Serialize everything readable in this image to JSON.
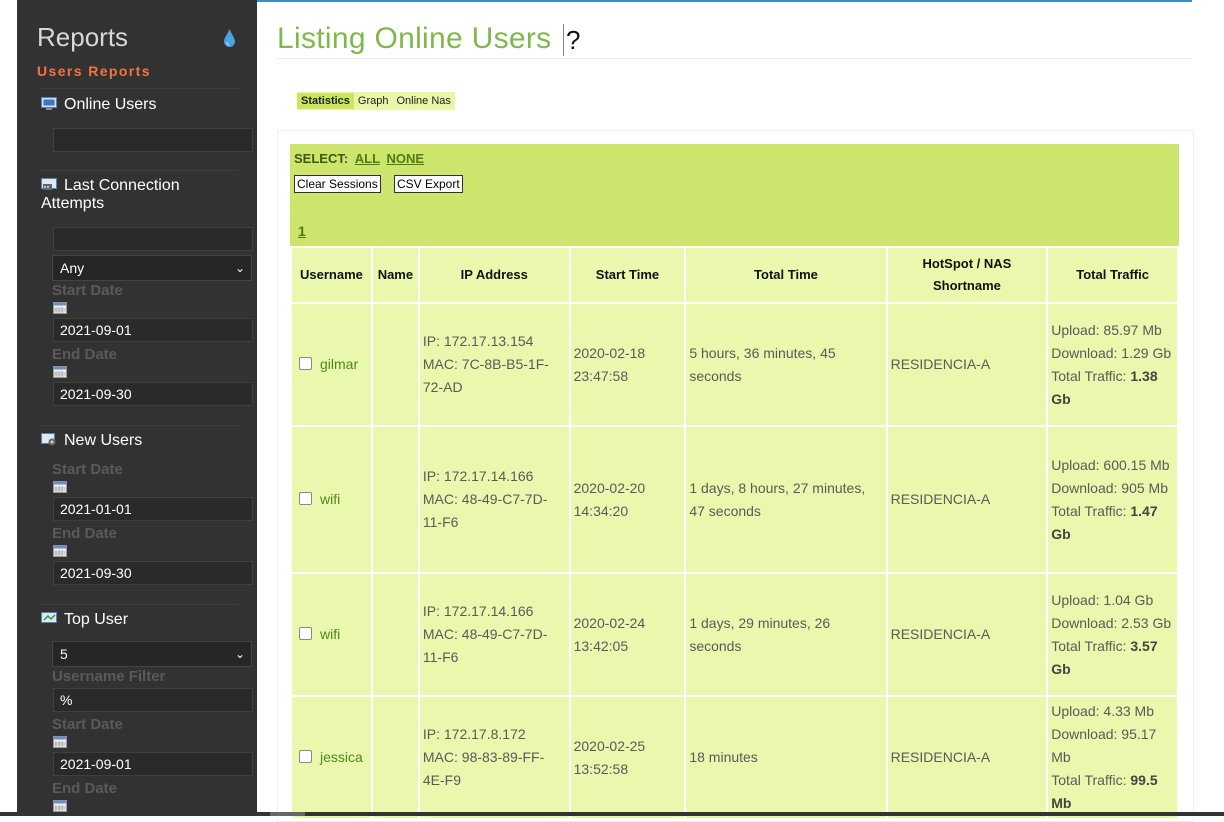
{
  "sidebar": {
    "title": "Reports",
    "subtitle": "Users Reports",
    "online_users": {
      "label": "Online Users",
      "input_value": ""
    },
    "last_connection": {
      "label": "Last Connection Attempts",
      "input_value": "",
      "select_value": "Any",
      "start_label": "Start Date",
      "start_value": "2021-09-01",
      "end_label": "End Date",
      "end_value": "2021-09-30"
    },
    "new_users": {
      "label": "New Users",
      "start_label": "Start Date",
      "start_value": "2021-01-01",
      "end_label": "End Date",
      "end_value": "2021-09-30"
    },
    "top_user": {
      "label": "Top User",
      "select_value": "5",
      "filter_label": "Username Filter",
      "filter_value": "%",
      "start_label": "Start Date",
      "start_value": "2021-09-01",
      "end_label": "End Date"
    }
  },
  "main": {
    "title": "Listing Online Users",
    "help": "?",
    "tabs": [
      "Statistics",
      "Graph",
      "Online Nas"
    ],
    "select_label": "SELECT:",
    "select_all": "ALL",
    "select_none": "NONE",
    "clear_sessions": "Clear Sessions",
    "csv_export": "CSV Export",
    "page": "1",
    "columns": [
      "Username",
      "Name",
      "IP Address",
      "Start Time",
      "Total Time",
      "HotSpot / NAS Shortname",
      "Total Traffic"
    ],
    "rows": [
      {
        "username": "gilmar",
        "name": "",
        "ip": "IP: 172.17.13.154",
        "mac": "MAC: 7C-8B-B5-1F-72-AD",
        "start": "2020-02-18 23:47:58",
        "total_time": "5 hours, 36 minutes, 45 seconds",
        "nas": "RESIDENCIA-A",
        "upload": "Upload: 85.97 Mb",
        "download": "Download: 1.29 Gb",
        "traffic_label": "Total Traffic:",
        "traffic": "1.38 Gb"
      },
      {
        "username": "wifi",
        "name": "",
        "ip": "IP: 172.17.14.166",
        "mac": "MAC: 48-49-C7-7D-11-F6",
        "start": "2020-02-20 14:34:20",
        "total_time": "1 days, 8 hours, 27 minutes, 47 seconds",
        "nas": "RESIDENCIA-A",
        "upload": "Upload: 600.15 Mb",
        "download": "Download: 905 Mb",
        "traffic_label": "Total Traffic:",
        "traffic": "1.47 Gb"
      },
      {
        "username": "wifi",
        "name": "",
        "ip": "IP: 172.17.14.166",
        "mac": "MAC: 48-49-C7-7D-11-F6",
        "start": "2020-02-24 13:42:05",
        "total_time": "1 days, 29 minutes, 26 seconds",
        "nas": "RESIDENCIA-A",
        "upload": "Upload: 1.04 Gb",
        "download": "Download: 2.53 Gb",
        "traffic_label": "Total Traffic:",
        "traffic": "3.57 Gb"
      },
      {
        "username": "jessica",
        "name": "",
        "ip": "IP: 172.17.8.172",
        "mac": "MAC: 98-83-89-FF-4E-F9",
        "start": "2020-02-25 13:52:58",
        "total_time": "18 minutes",
        "nas": "RESIDENCIA-A",
        "upload": "Upload: 4.33 Mb",
        "download": "Download: 95.17 Mb",
        "traffic_label": "Total Traffic:",
        "traffic": "99.5 Mb"
      }
    ]
  },
  "colors": {
    "accent_green": "#7fb94a",
    "sidebar_bg": "#323232",
    "table_bg": "#e9f8ad",
    "header_block": "#cde56d",
    "subtitle_orange": "#f7733e"
  },
  "icons": [
    "drop-icon",
    "monitor-icon",
    "connection-icon",
    "new-users-icon",
    "top-user-icon",
    "calendar-icon",
    "help-icon"
  ]
}
